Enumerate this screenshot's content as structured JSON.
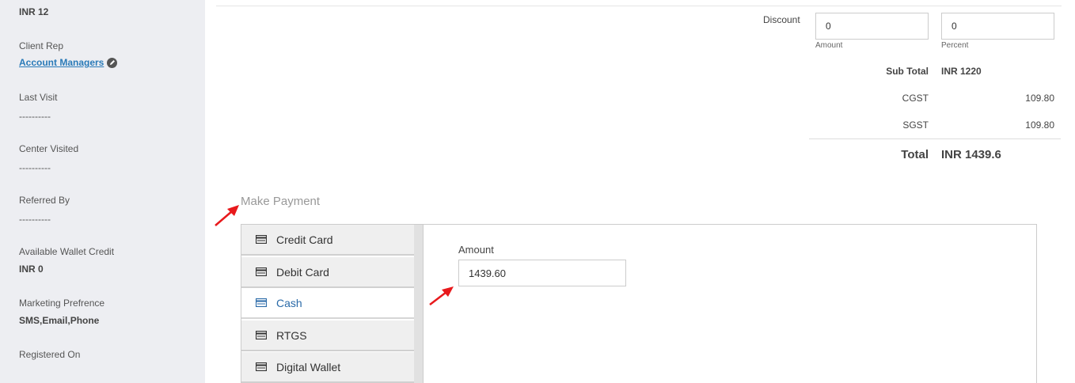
{
  "sidebar": {
    "top_value": "INR 12",
    "client_rep_label": "Client Rep",
    "client_rep_link": "Account Managers",
    "last_visit_label": "Last Visit",
    "last_visit_value": "----------",
    "center_visited_label": "Center Visited",
    "center_visited_value": "----------",
    "referred_by_label": "Referred By",
    "referred_by_value": "----------",
    "wallet_label": "Available Wallet Credit",
    "wallet_value": "INR 0",
    "marketing_label": "Marketing Prefrence",
    "marketing_value": "SMS,Email,Phone",
    "registered_label": "Registered On"
  },
  "discount": {
    "label": "Discount",
    "amount_value": "0",
    "amount_hint": "Amount",
    "percent_value": "0",
    "percent_hint": "Percent"
  },
  "summary": {
    "sub_total_label": "Sub Total",
    "sub_total_value": "INR 1220",
    "cgst_label": "CGST",
    "cgst_value": "109.80",
    "sgst_label": "SGST",
    "sgst_value": "109.80",
    "total_label": "Total",
    "total_value": "INR 1439.6"
  },
  "payment": {
    "heading": "Make Payment",
    "methods": [
      "Credit Card",
      "Debit Card",
      "Cash",
      "RTGS",
      "Digital Wallet"
    ],
    "active_method": "Cash",
    "amount_label": "Amount",
    "amount_value": "1439.60"
  },
  "colors": {
    "sidebar_bg": "#edeef2",
    "link": "#2a7ab8",
    "active_method": "#2a6aa8",
    "annotation_arrow": "#e8191c"
  }
}
